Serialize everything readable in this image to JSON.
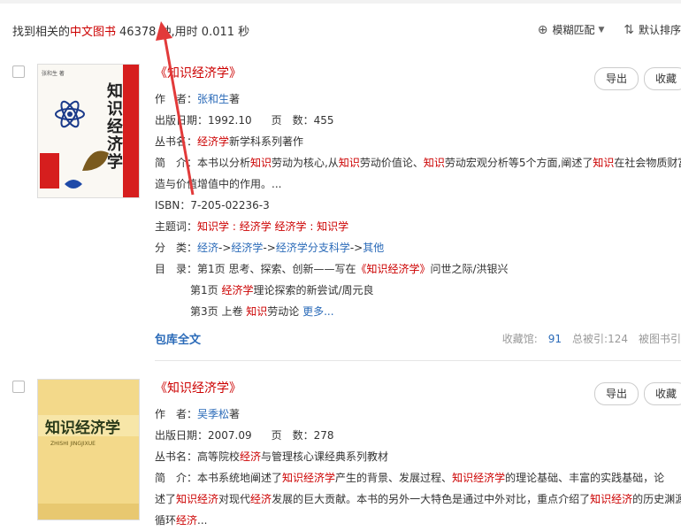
{
  "summary": {
    "prefix": "找到相关的",
    "lang": "中文图书",
    "count": "46378",
    "suffix": "种,用时 0.011 秒"
  },
  "sort": {
    "fuzzy": "模糊匹配",
    "default": "默认排序"
  },
  "records": [
    {
      "title": "《知识经济学》",
      "author_label": "作　者：",
      "author": "张和生",
      "author_suffix": "著",
      "date_label": "出版日期：",
      "date": "1992.10",
      "pages_label": "页　数：",
      "pages": "455",
      "series_label": "丛书名：",
      "series_kw": "经济学",
      "series_rest": "新学科系列著作",
      "abstract_label": "简　介：",
      "abstract_1": [
        "本书以分析",
        "知识",
        "劳动为核心,从",
        "知识",
        "劳动价值论、",
        "知识",
        "劳动宏观分析等5个方面,阐述了",
        "知识",
        "在社会物质财富创"
      ],
      "abstract_2": "造与价值增值中的作用。...",
      "isbn_label": "ISBN：",
      "isbn": "7-205-02236-3",
      "subject_label": "主题词：",
      "subjects": "知识学 : 经济学 经济学 : 知识学",
      "class_label": "分　类：",
      "class_path": [
        "经济",
        "->",
        "经济学",
        "->",
        "经济学分支科学",
        "->",
        "其他"
      ],
      "toc_label": "目　录：",
      "toc_1": [
        "第1页 思考、探索、创新——写在",
        "《知识经济学》",
        "问世之际/洪银兴"
      ],
      "toc_2": [
        "第1页 ",
        "经济学",
        "理论探索的新尝试/周元良"
      ],
      "toc_3": [
        "第3页 上卷 ",
        "知识",
        "劳动论 ",
        "更多..."
      ],
      "fulltext": "包库全文",
      "stat_fav": "收藏馆:",
      "stat_fav_n": "91",
      "stat_cite": "总被引:124",
      "stat_cited": "被图书引",
      "btn_export": "导出",
      "btn_fav": "收藏",
      "cover_title": "知识经济学",
      "cover_author": "张和生 著"
    },
    {
      "title": "《知识经济学》",
      "author_label": "作　者：",
      "author": "吴季松",
      "author_suffix": "著",
      "date_label": "出版日期：",
      "date": "2007.09",
      "pages_label": "页　数：",
      "pages": "278",
      "series_label": "丛书名：",
      "series_pre": "高等院校",
      "series_kw": "经济",
      "series_rest": "与管理核心课经典系列教材",
      "abstract_label": "简　介：",
      "abstract_1": [
        "本书系统地阐述了",
        "知识经济学",
        "产生的背景、发展过程、",
        "知识经济学",
        "的理论基础、丰富的实践基础，论"
      ],
      "abstract_2": [
        "述了",
        "知识经济",
        "对现代",
        "经济",
        "发展的巨大贡献。本书的另外一大特色是通过中外对比，重点介绍了",
        "知识经济",
        "的历史渊源"
      ],
      "abstract_3": [
        "循环",
        "经济",
        "..."
      ],
      "btn_export": "导出",
      "btn_fav": "收藏",
      "cover_title": "知识经济学",
      "cover_pinyin": "ZHISHI JINGJIXUE"
    }
  ],
  "colors": {
    "red": "#c00000",
    "blue": "#2a6ab8",
    "arrow": "#e23a3a"
  }
}
